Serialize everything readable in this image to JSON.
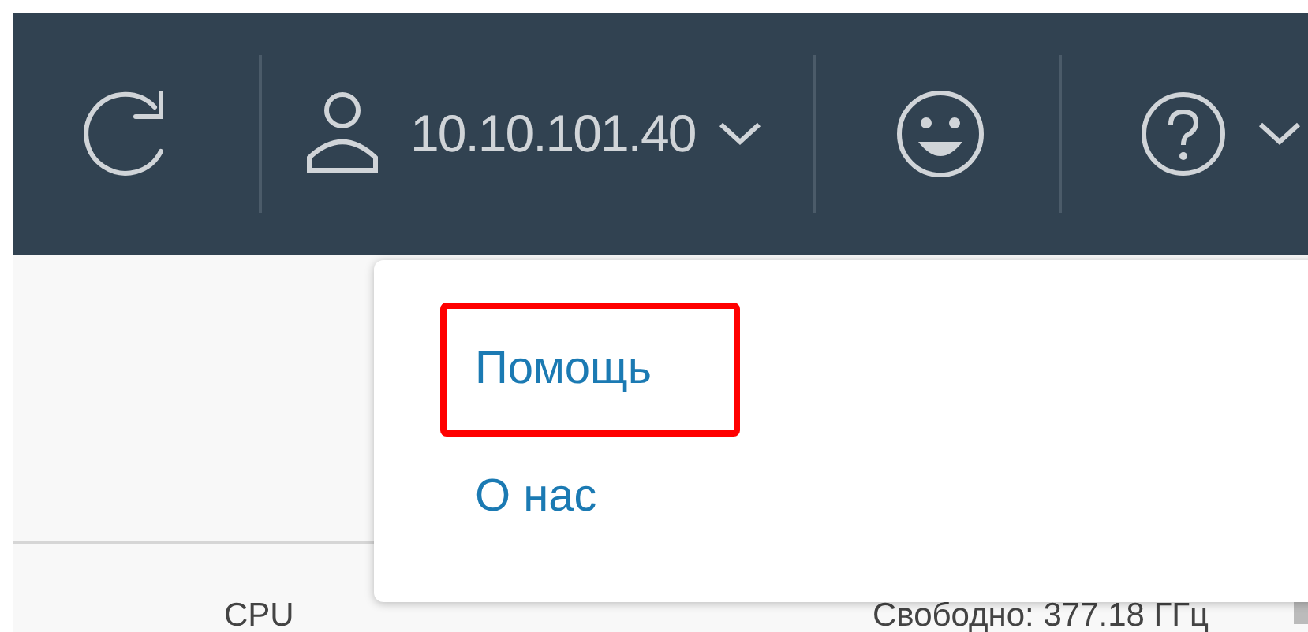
{
  "header": {
    "user": {
      "label": "10.10.101.40"
    }
  },
  "help_menu": {
    "items": [
      {
        "label": "Помощь",
        "highlighted": true
      },
      {
        "label": "О нас",
        "highlighted": false
      }
    ]
  },
  "table": {
    "column_label": "CPU",
    "free": "Свободно: 377.18 ГГц"
  }
}
